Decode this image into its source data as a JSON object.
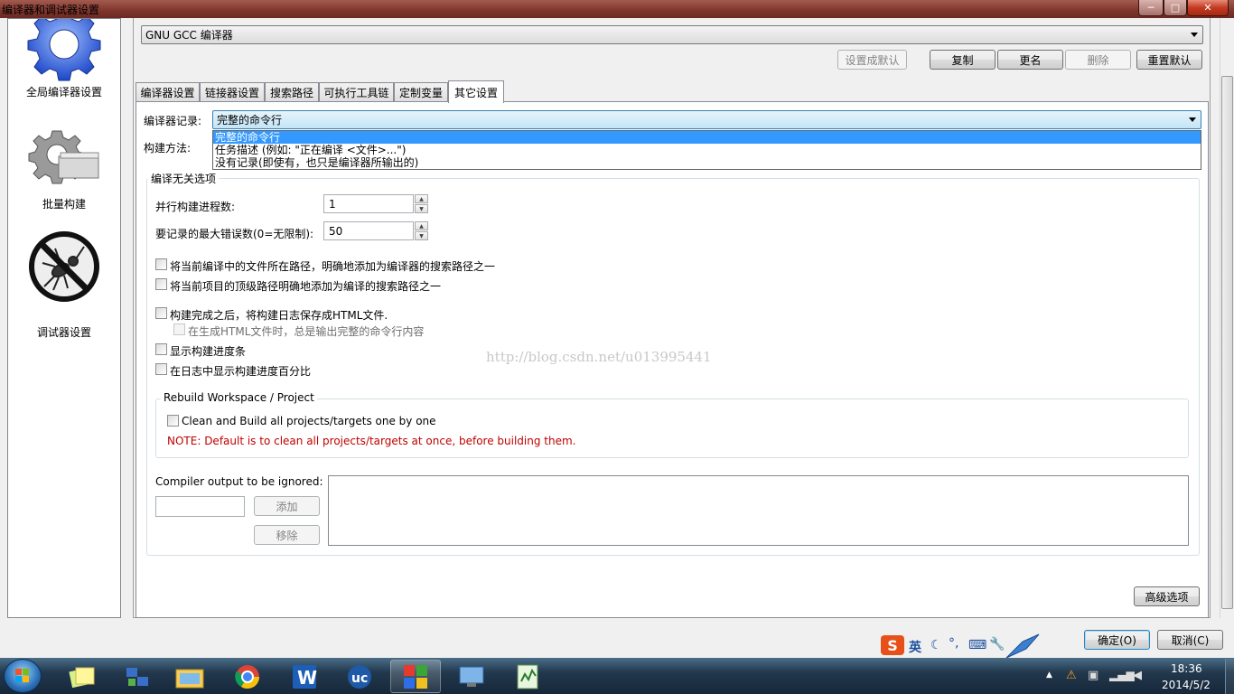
{
  "window": {
    "title": "编译器和调试器设置",
    "min_glyph": "─",
    "max_glyph": "□",
    "close_glyph": "✕"
  },
  "sidebar": {
    "items": [
      {
        "label": "全局编译器设置",
        "icon": "gear-icon"
      },
      {
        "label": "批量构建",
        "icon": "batch-build-icon"
      },
      {
        "label": "调试器设置",
        "icon": "debugger-bug-icon"
      }
    ]
  },
  "compiler_select": {
    "value": "GNU GCC 编译器"
  },
  "toolbar": {
    "set_default": "设置成默认",
    "copy": "复制",
    "rename": "更名",
    "delete": "删除",
    "reset_default": "重置默认"
  },
  "tabs": [
    "编译器设置",
    "链接器设置",
    "搜索路径",
    "可执行工具链",
    "定制变量",
    "其它设置"
  ],
  "logging": {
    "label": "编译器记录:",
    "value": "完整的命令行",
    "options": [
      "完整的命令行",
      "任务描述 (例如: \"正在编译 <文件>...\")",
      "没有记录(即使有，也只是编译器所输出的)"
    ]
  },
  "build_method": {
    "label": "构建方法:"
  },
  "independent": {
    "title": "编译无关选项",
    "parallel_label": "并行构建进程数:",
    "parallel_value": "1",
    "max_errors_label": "要记录的最大错误数(0=无限制):",
    "max_errors_value": "50"
  },
  "checks": {
    "c1": "将当前编译中的文件所在路径，明确地添加为编译器的搜索路径之一",
    "c2": "将当前项目的顶级路径明确地添加为编译的搜索路径之一",
    "c3": "构建完成之后，将构建日志保存成HTML文件.",
    "c3a": "在生成HTML文件时，总是输出完整的命令行内容",
    "c4": "显示构建进度条",
    "c5": "在日志中显示构建进度百分比"
  },
  "watermark": "http://blog.csdn.net/u013995441",
  "rebuild": {
    "title": "Rebuild Workspace / Project",
    "checkbox": "Clean and Build all projects/targets one by one",
    "note": "NOTE: Default is to clean all projects/targets at once, before building them."
  },
  "ignored": {
    "label": "Compiler output to be ignored:",
    "add": "添加",
    "remove": "移除"
  },
  "advanced": "高级选项",
  "ok": "确定(O)",
  "cancel": "取消(C)",
  "ime": {
    "s": "S",
    "lang": "英"
  },
  "clock": {
    "time": "18:36",
    "date": "2014/5/2"
  },
  "colors": {
    "note": "#c00000",
    "selected": "#3399ff",
    "titlebar": "#7e342b"
  }
}
